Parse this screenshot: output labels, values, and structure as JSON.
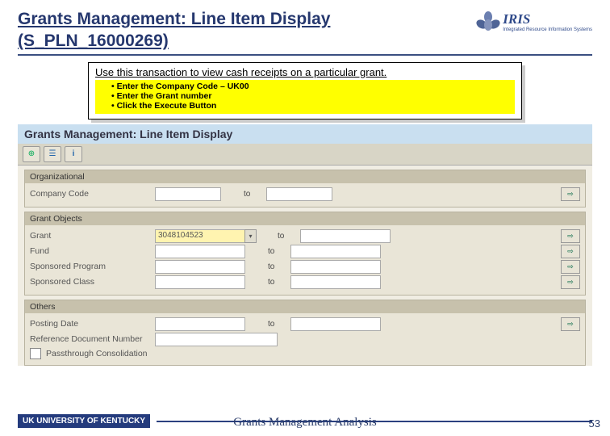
{
  "title_line1": "Grants Management: Line Item Display",
  "title_line2": "(S_PLN_16000269)",
  "iris_label": "IRIS",
  "iris_sub": "Integrated Resource Information Systems",
  "instruction_main": "Use this transaction to view cash receipts on a particular grant.",
  "instruction_items": {
    "a": "Enter the Company Code – UK00",
    "b": "Enter the Grant number",
    "c": "Click the Execute Button"
  },
  "sap_title": "Grants Management: Line Item Display",
  "toolbar": {
    "execute": "⊕",
    "variant": "☰",
    "info": "i"
  },
  "panels": {
    "org": {
      "head": "Organizational",
      "company_code_lbl": "Company Code",
      "to": "to"
    },
    "grant": {
      "head": "Grant Objects",
      "grant_lbl": "Grant",
      "grant_val": "3048104523",
      "fund_lbl": "Fund",
      "sprog_lbl": "Sponsored Program",
      "sclass_lbl": "Sponsored Class",
      "to": "to"
    },
    "others": {
      "head": "Others",
      "posting_lbl": "Posting Date",
      "refdoc_lbl": "Reference Document Number",
      "passthru_lbl": "Passthrough Consolidation",
      "to": "to"
    }
  },
  "uk_logo": "UK UNIVERSITY OF KENTUCKY",
  "footer_title": "Grants Management Analysis",
  "page_number": "53"
}
